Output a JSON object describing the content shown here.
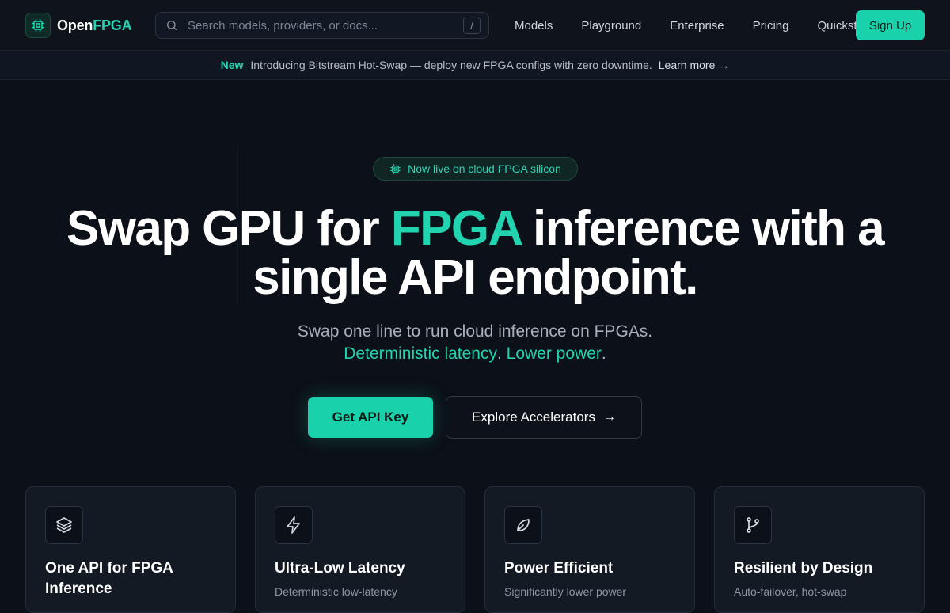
{
  "nav": {
    "logo": {
      "prefix": "Open",
      "accent": "FPGA"
    },
    "search": {
      "placeholder": "Search models, providers, or docs...",
      "shortcut": "/"
    },
    "links": [
      "Models",
      "Playground",
      "Enterprise",
      "Pricing",
      "Quickstart"
    ],
    "signup_label": "Sign Up"
  },
  "announcement": {
    "badge": "New",
    "message": "Introducing Bitstream Hot-Swap — deploy new FPGA configs with zero downtime.",
    "link_label": "Learn more",
    "link_arrow": "→"
  },
  "hero": {
    "pill": "Now live on cloud FPGA silicon",
    "title_part1": "Swap GPU for ",
    "title_highlight": "FPGA",
    "title_part2": " inference with a",
    "title_line2": "single API endpoint.",
    "subtitle_line1": "Swap one line to run cloud inference on FPGAs.",
    "subtitle_hl1": "Deterministic latency",
    "subtitle_sep": ". ",
    "subtitle_hl2": "Lower power",
    "subtitle_end": ".",
    "primary_cta": "Get API Key",
    "secondary_cta": "Explore Accelerators",
    "secondary_arrow": "→"
  },
  "features": [
    {
      "icon": "layers-icon",
      "title": "One API for FPGA Inference",
      "desc": ""
    },
    {
      "icon": "lightning-icon",
      "title": "Ultra-Low Latency",
      "desc": "Deterministic low-latency"
    },
    {
      "icon": "leaf-icon",
      "title": "Power Efficient",
      "desc": "Significantly lower power"
    },
    {
      "icon": "git-branch-icon",
      "title": "Resilient by Design",
      "desc": "Auto-failover, hot-swap"
    }
  ],
  "colors": {
    "accent": "#19d2ac",
    "background": "#0c1018",
    "card": "#141a24"
  }
}
